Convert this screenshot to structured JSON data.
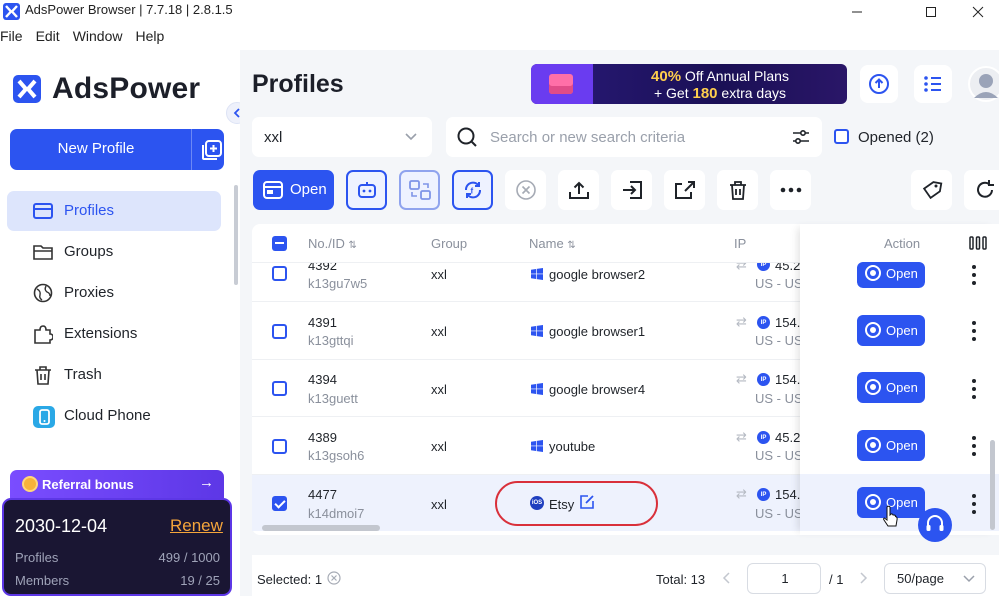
{
  "window": {
    "title": "AdsPower Browser | 7.7.18 | 2.8.1.5"
  },
  "menu": [
    "File",
    "Edit",
    "Window",
    "Help"
  ],
  "sidebar": {
    "brand": "AdsPower",
    "new_profile_label": "New Profile",
    "items": [
      {
        "label": "Profiles",
        "icon": "profiles-icon",
        "active": true
      },
      {
        "label": "Groups",
        "icon": "folder-icon"
      },
      {
        "label": "Proxies",
        "icon": "globe-icon"
      },
      {
        "label": "Extensions",
        "icon": "puzzle-icon"
      },
      {
        "label": "Trash",
        "icon": "trash-icon"
      },
      {
        "label": "Cloud Phone",
        "icon": "cloud-phone-icon"
      }
    ],
    "referral_label": "Referral bonus",
    "plan": {
      "expiry": "2030-12-04",
      "renew_label": "Renew",
      "profiles_label": "Profiles",
      "profiles_value": "499 / 1000",
      "members_label": "Members",
      "members_value": "19 / 25"
    }
  },
  "header": {
    "title": "Profiles",
    "promo_line1_pct": "40%",
    "promo_line1_rest": " Off Annual Plans",
    "promo_line2_pre": "+ Get ",
    "promo_line2_num": "180",
    "promo_line2_post": " extra days"
  },
  "filters": {
    "group_value": "xxl",
    "search_placeholder": "Search or new search criteria",
    "opened_label": "Opened (2)"
  },
  "toolbar": {
    "open_label": "Open"
  },
  "table": {
    "columns": {
      "no": "No./ID",
      "group": "Group",
      "name": "Name",
      "ip": "IP",
      "action": "Action"
    },
    "rows": [
      {
        "no": "4392",
        "id": "k13gu7w5",
        "group": "xxl",
        "name": "google browser2",
        "os": "windows",
        "ip": "45.2",
        "region": "US - US",
        "checked": false
      },
      {
        "no": "4391",
        "id": "k13gttqi",
        "group": "xxl",
        "name": "google browser1",
        "os": "windows",
        "ip": "154.:",
        "region": "US - US",
        "checked": false
      },
      {
        "no": "4394",
        "id": "k13guett",
        "group": "xxl",
        "name": "google browser4",
        "os": "windows",
        "ip": "154.:",
        "region": "US - US",
        "checked": false
      },
      {
        "no": "4389",
        "id": "k13gsoh6",
        "group": "xxl",
        "name": "youtube",
        "os": "windows",
        "ip": "45.2",
        "region": "US - US",
        "checked": false
      },
      {
        "no": "4477",
        "id": "k14dmoi7",
        "group": "xxl",
        "name": "Etsy",
        "os": "ios",
        "ip": "154.:",
        "region": "US - US",
        "checked": true
      }
    ],
    "row_open_label": "Open"
  },
  "footer": {
    "selected": "Selected: 1",
    "total": "Total: 13",
    "page_current": "1",
    "page_total": "/ 1",
    "per_page": "50/page"
  },
  "colors": {
    "accent": "#2c54f0",
    "highlight_oval": "#d9303a",
    "active_nav_bg": "#dde5fc"
  }
}
